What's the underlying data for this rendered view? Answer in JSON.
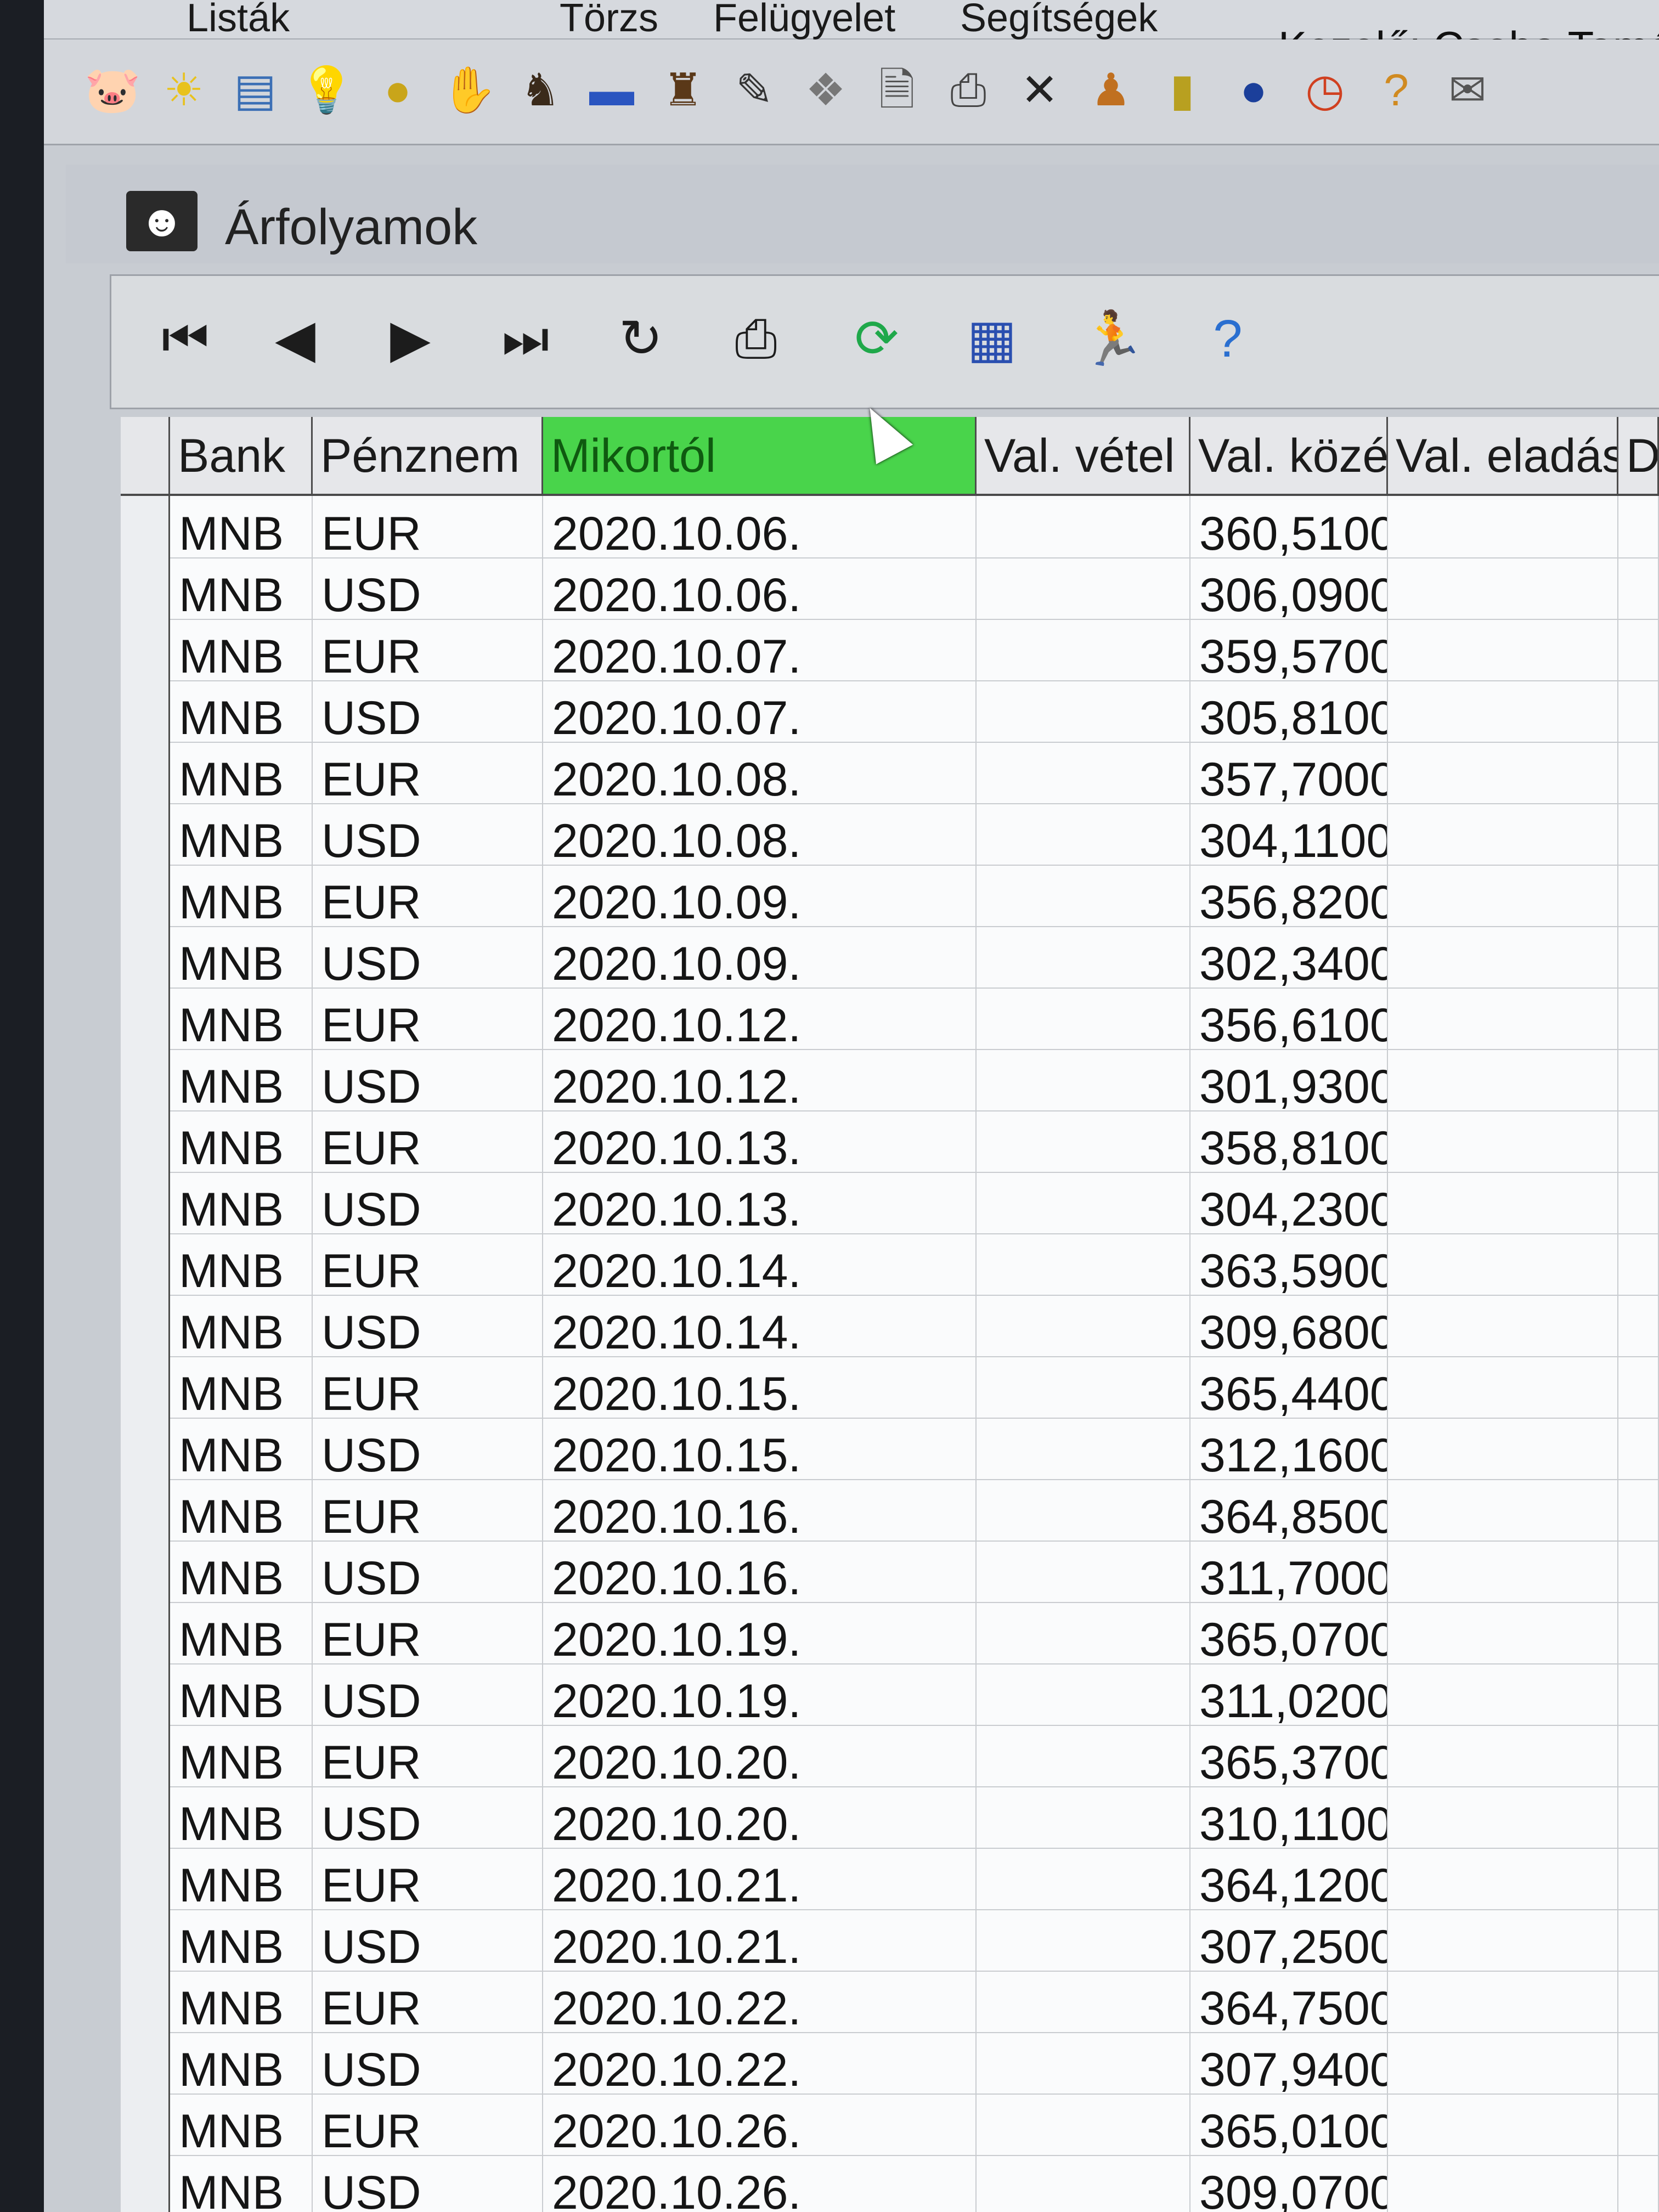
{
  "menu": {
    "items": [
      "Listák",
      "Törzs",
      "Felügyelet",
      "Segítségek"
    ],
    "operator": "Kezelő: Csoba Tamás (B"
  },
  "toolbar_icons": [
    "pig-icon",
    "sun-icon",
    "map-icon",
    "bulb-icon",
    "coin-icon",
    "hand-icon",
    "bear-icon",
    "car-icon",
    "bear2-icon",
    "pencil-icon",
    "coins-icon",
    "document-search-icon",
    "printer-icon",
    "close-icon",
    "person-icon",
    "book-icon",
    "globe-icon",
    "clock-icon",
    "help-icon",
    "notes-icon"
  ],
  "window": {
    "title": "Árfolyamok"
  },
  "nav_buttons": [
    "first-icon",
    "prior-icon",
    "next-icon",
    "last-icon",
    "refresh-icon",
    "print-icon",
    "sync-icon",
    "calendar-icon",
    "exit-icon",
    "help-icon"
  ],
  "grid": {
    "columns": [
      "Bank",
      "Pénznem",
      "Mikortól",
      "Val. vétel",
      "Val. közép",
      "Val. eladási",
      "D"
    ],
    "active_column": "Mikortól",
    "active_color": "#49d44b",
    "rows": [
      [
        "MNB",
        "EUR",
        "2020.10.06.",
        "",
        "360,5100"
      ],
      [
        "MNB",
        "USD",
        "2020.10.06.",
        "",
        "306,0900"
      ],
      [
        "MNB",
        "EUR",
        "2020.10.07.",
        "",
        "359,5700"
      ],
      [
        "MNB",
        "USD",
        "2020.10.07.",
        "",
        "305,8100"
      ],
      [
        "MNB",
        "EUR",
        "2020.10.08.",
        "",
        "357,7000"
      ],
      [
        "MNB",
        "USD",
        "2020.10.08.",
        "",
        "304,1100"
      ],
      [
        "MNB",
        "EUR",
        "2020.10.09.",
        "",
        "356,8200"
      ],
      [
        "MNB",
        "USD",
        "2020.10.09.",
        "",
        "302,3400"
      ],
      [
        "MNB",
        "EUR",
        "2020.10.12.",
        "",
        "356,6100"
      ],
      [
        "MNB",
        "USD",
        "2020.10.12.",
        "",
        "301,9300"
      ],
      [
        "MNB",
        "EUR",
        "2020.10.13.",
        "",
        "358,8100"
      ],
      [
        "MNB",
        "USD",
        "2020.10.13.",
        "",
        "304,2300"
      ],
      [
        "MNB",
        "EUR",
        "2020.10.14.",
        "",
        "363,5900"
      ],
      [
        "MNB",
        "USD",
        "2020.10.14.",
        "",
        "309,6800"
      ],
      [
        "MNB",
        "EUR",
        "2020.10.15.",
        "",
        "365,4400"
      ],
      [
        "MNB",
        "USD",
        "2020.10.15.",
        "",
        "312,1600"
      ],
      [
        "MNB",
        "EUR",
        "2020.10.16.",
        "",
        "364,8500"
      ],
      [
        "MNB",
        "USD",
        "2020.10.16.",
        "",
        "311,7000"
      ],
      [
        "MNB",
        "EUR",
        "2020.10.19.",
        "",
        "365,0700"
      ],
      [
        "MNB",
        "USD",
        "2020.10.19.",
        "",
        "311,0200"
      ],
      [
        "MNB",
        "EUR",
        "2020.10.20.",
        "",
        "365,3700"
      ],
      [
        "MNB",
        "USD",
        "2020.10.20.",
        "",
        "310,1100"
      ],
      [
        "MNB",
        "EUR",
        "2020.10.21.",
        "",
        "364,1200"
      ],
      [
        "MNB",
        "USD",
        "2020.10.21.",
        "",
        "307,2500"
      ],
      [
        "MNB",
        "EUR",
        "2020.10.22.",
        "",
        "364,7500"
      ],
      [
        "MNB",
        "USD",
        "2020.10.22.",
        "",
        "307,9400"
      ],
      [
        "MNB",
        "EUR",
        "2020.10.26.",
        "",
        "365,0100"
      ],
      [
        "MNB",
        "USD",
        "2020.10.26.",
        "",
        "309,0700"
      ]
    ]
  }
}
